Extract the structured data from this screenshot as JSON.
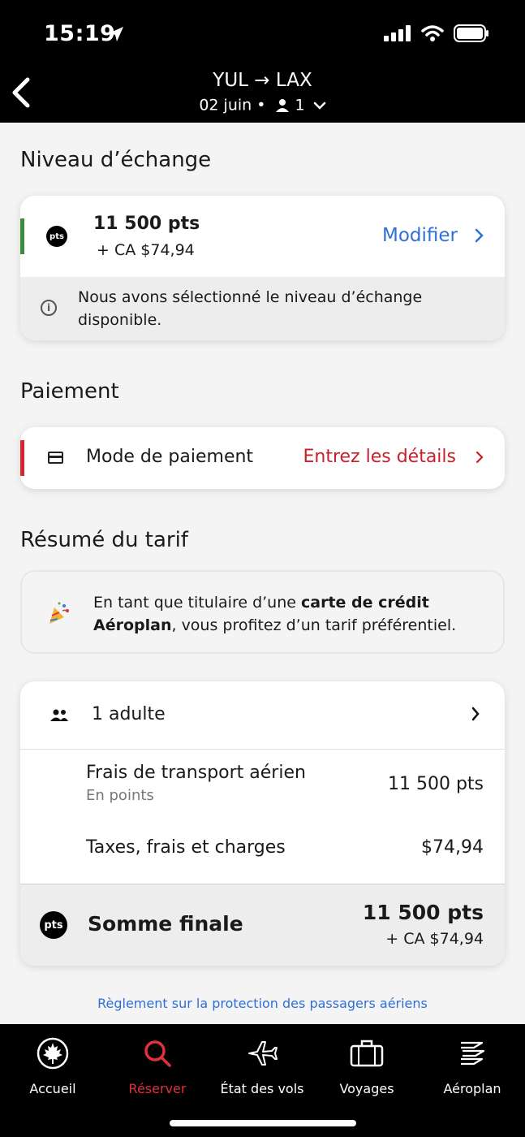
{
  "status_bar": {
    "time": "15:19"
  },
  "header": {
    "route": "YUL → LAX",
    "date": "02 juin •",
    "passengers": "1"
  },
  "redemption": {
    "section_title": "Niveau d’échange",
    "badge": "pts",
    "points": "11 500 pts",
    "cash": "+ CA $74,94",
    "modify_label": "Modifier",
    "info": "Nous avons sélectionné le niveau d’échange disponible."
  },
  "payment": {
    "section_title": "Paiement",
    "label": "Mode de paiement",
    "action": "Entrez les détails"
  },
  "fare_summary": {
    "section_title": "Résumé du tarif",
    "promo_prefix": "En tant que titulaire d’une ",
    "promo_bold": "carte de crédit Aéroplan",
    "promo_suffix": ", vous profitez d’un tarif préférentiel.",
    "adult_label": "1 adulte",
    "transport_label": "Frais de transport aérien",
    "transport_sub": "En points",
    "transport_value": "11 500  pts",
    "tax_label": "Taxes, frais et charges",
    "tax_value": "$74,94",
    "total_label": "Somme finale",
    "total_points": "11 500 pts",
    "total_cash": "+ CA $74,94",
    "badge": "pts"
  },
  "regulation_link": "Règlement sur la protection des passagers aériens",
  "tabs": [
    {
      "label": "Accueil",
      "icon": "maple-leaf-icon"
    },
    {
      "label": "Réserver",
      "icon": "search-icon",
      "active": true
    },
    {
      "label": "État des vols",
      "icon": "plane-icon"
    },
    {
      "label": "Voyages",
      "icon": "suitcase-icon"
    },
    {
      "label": "Aéroplan",
      "icon": "aeroplan-icon"
    }
  ],
  "colors": {
    "accent_red": "#d22630",
    "link_blue": "#2f6fd6",
    "redemption_green": "#3d8b3d"
  }
}
